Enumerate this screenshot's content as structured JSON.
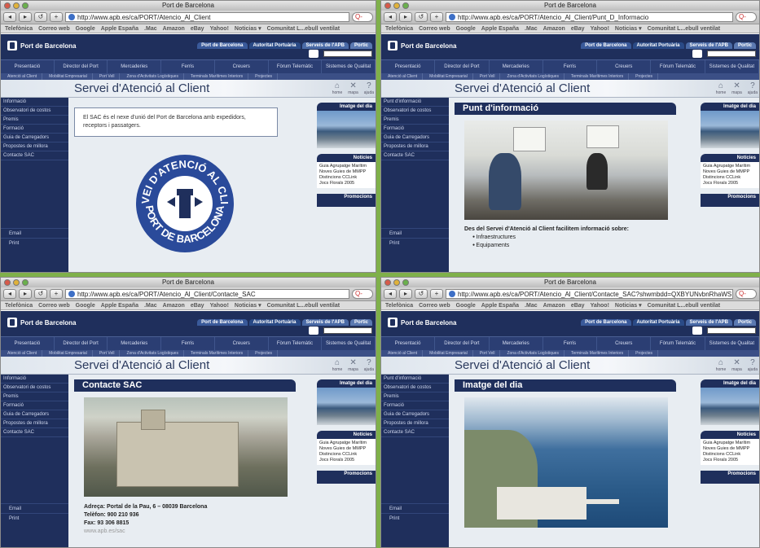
{
  "colors": {
    "accent": "#1f2f5c",
    "frame": "#7fb04a"
  },
  "windows": [
    {
      "title": "Port de Barcelona",
      "url": "http://www.apb.es/ca/PORT/Atencio_Al_Client",
      "search": "Q-",
      "variant": "intro",
      "sidebar": [
        "Informació",
        "Observatori de costos",
        "Premis",
        "Formació",
        "Guia de Carregadors",
        "Propostes de millora",
        "Contacte SAC"
      ],
      "sac_text": "El SAC és el nexe d'unió del Port de Barcelona amb expedidors, receptors i passatgers."
    },
    {
      "title": "Port de Barcelona",
      "url": "http://www.apb.es/ca/PORT/Atencio_Al_Client/Punt_D_Informacio",
      "search": "Q-",
      "variant": "info",
      "sidebar": [
        "Punt d'informació",
        "Observatori de costos",
        "Premis",
        "Formació",
        "Guia de Carregadors",
        "Propostes de millora",
        "Contacte SAC"
      ],
      "section": "Punt d'informació",
      "info_text": "Des del Servei d'Atenció al Client facilitem informació sobre:",
      "bullets": [
        "Infraestructures",
        "Equipaments"
      ]
    },
    {
      "title": "Port de Barcelona",
      "url": "http://www.apb.es/ca/PORT/Atencio_Al_Client/Contacte_SAC",
      "search": "Q-",
      "variant": "contact",
      "sidebar": [
        "Informació",
        "Observatori de costos",
        "Premis",
        "Formació",
        "Guia de Carregadors",
        "Propostes de millora",
        "Contacte SAC"
      ],
      "section": "Contacte SAC",
      "address": "Adreça: Portal de la Pau, 6 – 08039 Barcelona",
      "phone": "Telèfon: 900 210 936",
      "fax": "Fax: 93 306 8815",
      "web": "www.apb.es/sac"
    },
    {
      "title": "Port de Barcelona",
      "url": "http://www.apb.es/ca/PORT/Atencio_Al_Client/Contacte_SAC?shwmbdd=QXBYUNvbnRhaWS",
      "search": "Q-",
      "variant": "image",
      "sidebar": [
        "Punt d'informació",
        "Observatori de costos",
        "Premis",
        "Formació",
        "Guia de Carregadors",
        "Propostes de millora",
        "Contacte SAC"
      ],
      "section": "Imatge del dia"
    }
  ],
  "toolbar": {
    "back": "◂",
    "forward": "▸",
    "reload": "↺",
    "add": "+"
  },
  "bookmarks": [
    "Telefònica",
    "Correo web",
    "Google",
    "Apple España",
    ".Mac",
    "Amazon",
    "eBay",
    "Yahoo!",
    "Noticias ▾",
    "Comunitat L...ebull ventilat"
  ],
  "site": {
    "logo": "Port de Barcelona",
    "top_tabs": [
      "Port de Barcelona",
      "Autoritat Portuària",
      "Serveis de l'APB",
      "Portic"
    ],
    "menu": [
      "Presentació",
      "Director del Port",
      "Mercaderies",
      "Ferris",
      "Creuers",
      "Fòrum Telemàtic",
      "Sistemes de Qualitat"
    ],
    "submenu": [
      "Atenció al Client",
      "Mobilitat Empresarial",
      "Port Vell",
      "Zona d'Activitats Logístiques",
      "Terminals Marítimes Interiors",
      "Projectes"
    ],
    "page_title": "Servei d'Atenció al Client",
    "banner_icons": [
      {
        "icon": "home-icon",
        "label": "home",
        "glyph": "⌂"
      },
      {
        "icon": "map-icon",
        "label": "mapa",
        "glyph": "✕"
      },
      {
        "icon": "help-icon",
        "label": "ajuda",
        "glyph": "?"
      }
    ],
    "image_of_day": "Imatge del dia",
    "news_title": "Notícies",
    "news": [
      "Guia Agrupatge Marítim",
      "Noves Guies de MMPP",
      "Distincions CCLink",
      "Jocs Florals 2005"
    ],
    "promo_title": "Promocions",
    "sidebar_footer": [
      "Email",
      "Print"
    ]
  },
  "seal": {
    "top": "SERVEI D'ATENCIÓ AL CLIENT",
    "bottom": "PORT DE BARCELONA"
  }
}
